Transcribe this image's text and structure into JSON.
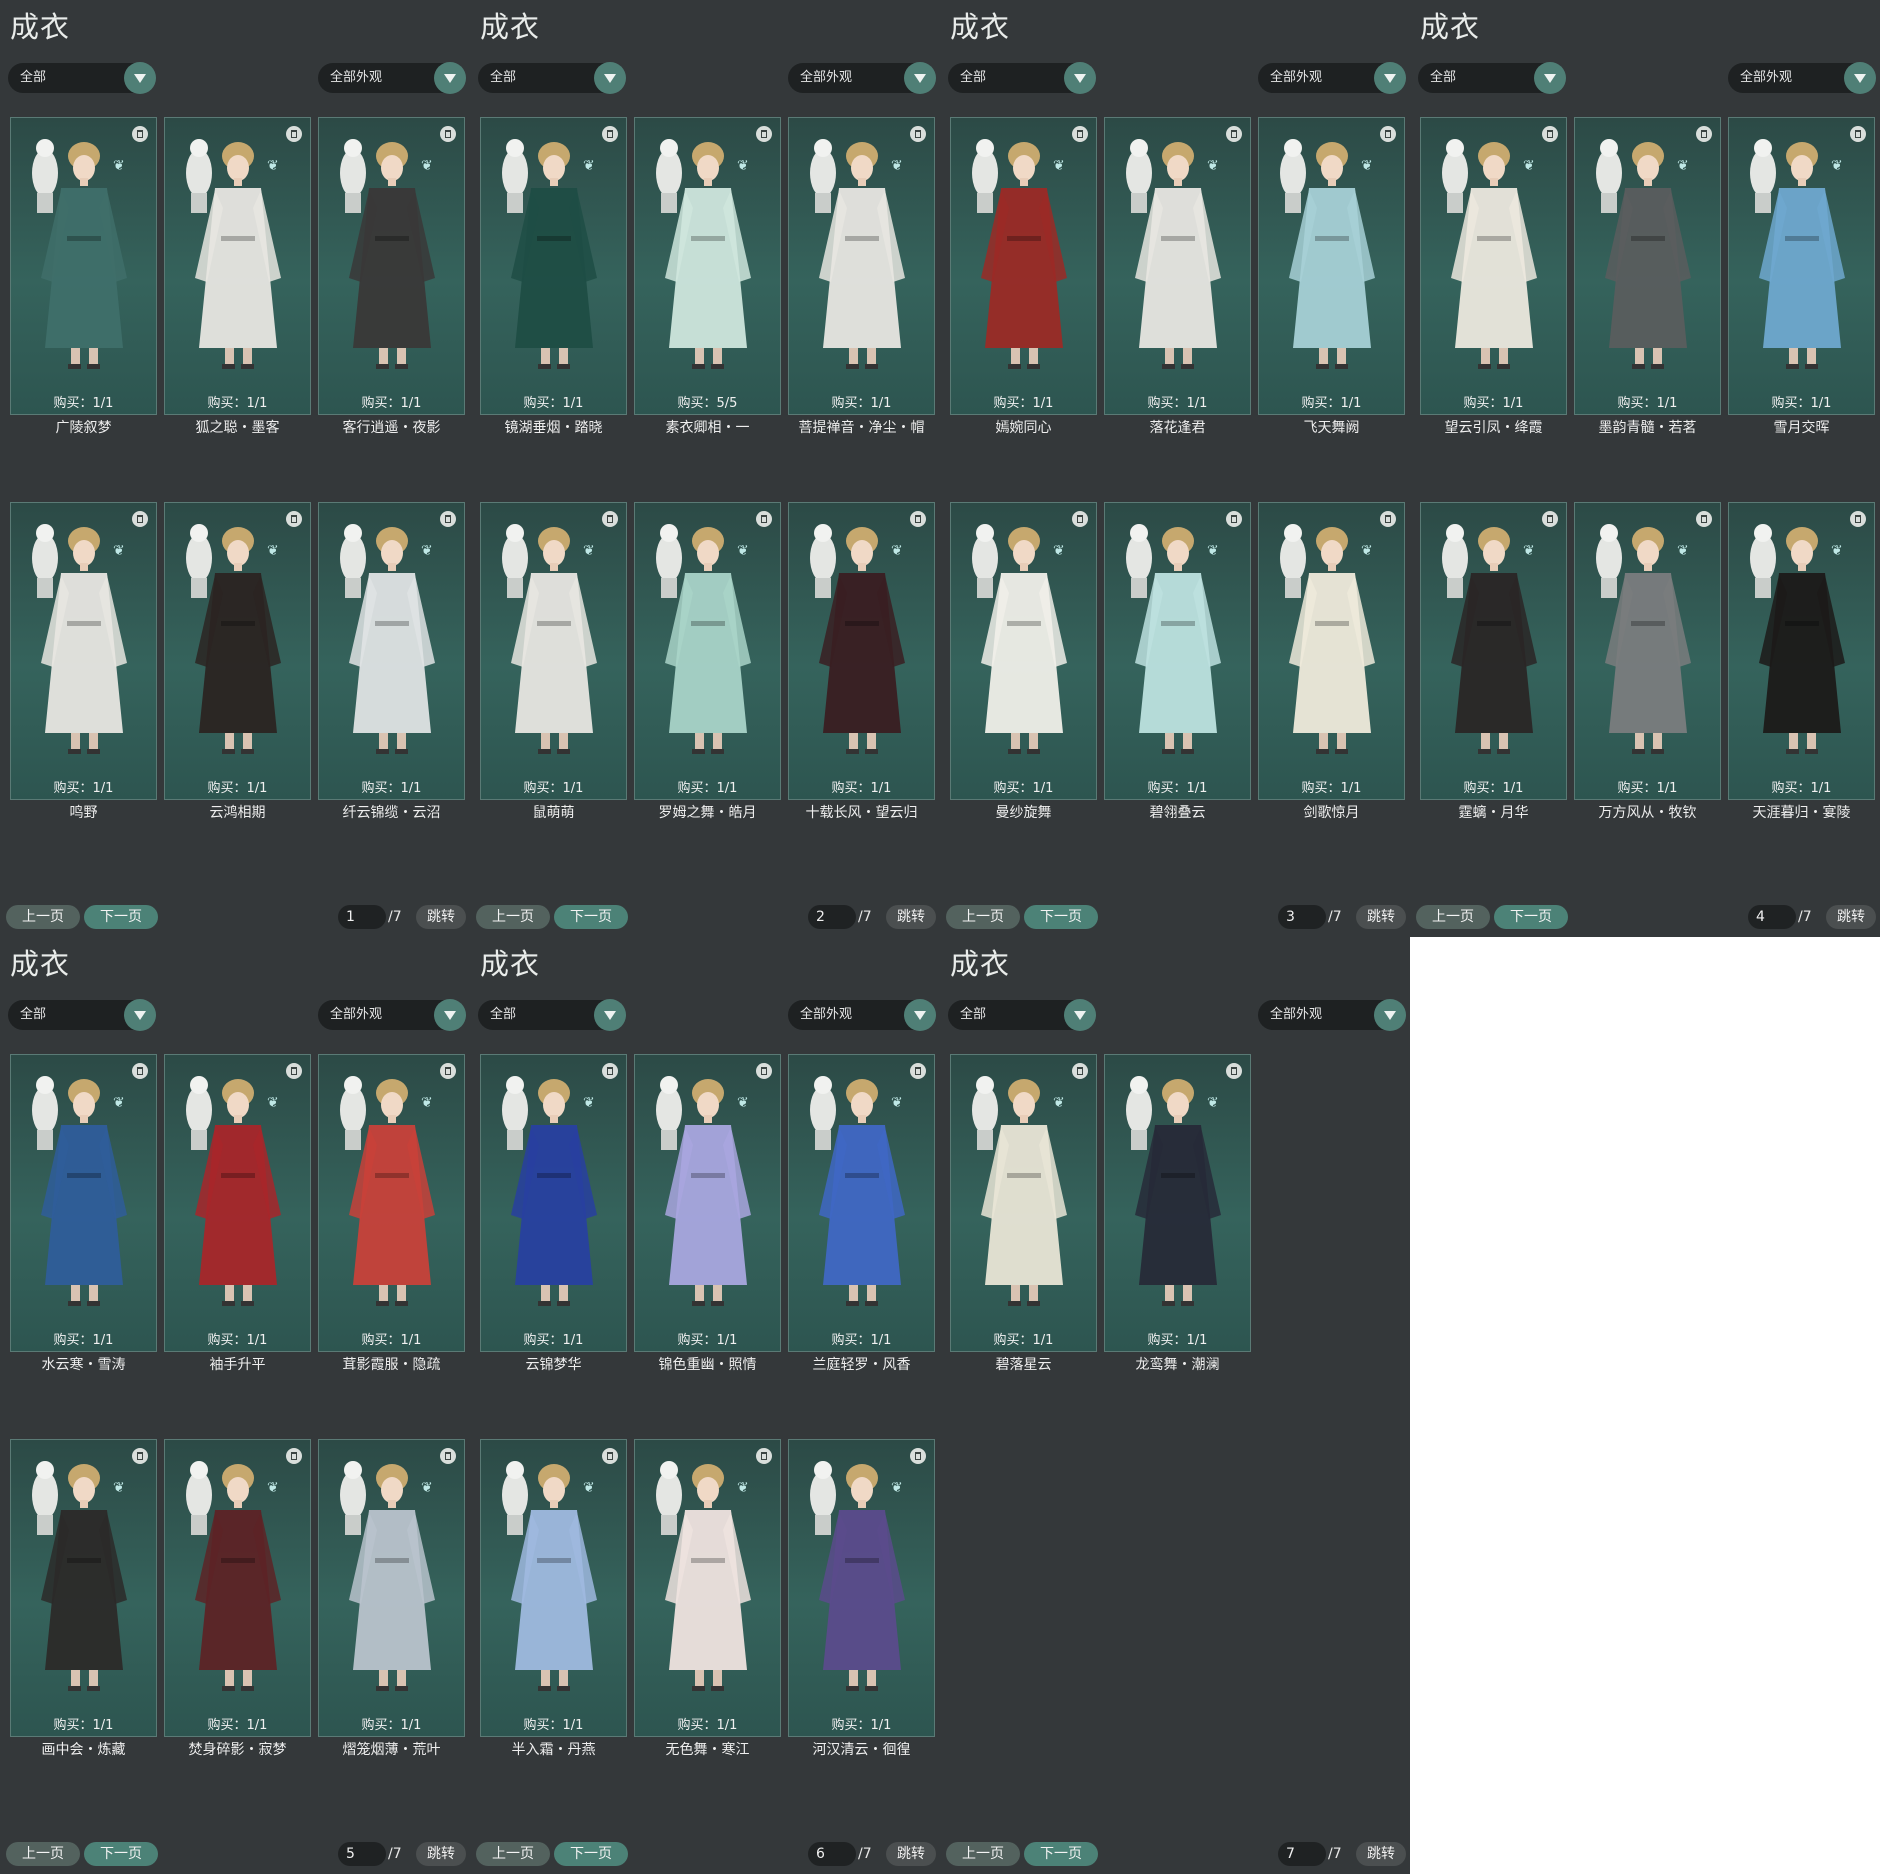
{
  "panel_title": "成衣",
  "filter_all": "全部",
  "filter_appearance": "全部外观",
  "prev_label": "上一页",
  "next_label": "下一页",
  "jump_label": "跳转",
  "total_pages": "/7",
  "pages": [
    {
      "page": "1",
      "items": [
        {
          "name": "广陵叙梦",
          "buy": "购买：1/1",
          "outfit": "#3f6f6a"
        },
        {
          "name": "狐之聪・墨客",
          "buy": "购买：1/1",
          "outfit": "#e8e6e1"
        },
        {
          "name": "客行逍遥・夜影",
          "buy": "购买：1/1",
          "outfit": "#3a3838"
        },
        {
          "name": "鸣野",
          "buy": "购买：1/1",
          "outfit": "#e8e6e1"
        },
        {
          "name": "云鸿相期",
          "buy": "购买：1/1",
          "outfit": "#2b2422"
        },
        {
          "name": "纤云锦缆・云沼",
          "buy": "购买：1/1",
          "outfit": "#dfe3e4"
        }
      ]
    },
    {
      "page": "2",
      "items": [
        {
          "name": "镜湖垂烟・踏晓",
          "buy": "购买：1/1",
          "outfit": "#1f4d45"
        },
        {
          "name": "素衣卿相・一",
          "buy": "购买：5/5",
          "outfit": "#cfe6dd"
        },
        {
          "name": "菩提禅音・净尘・帽",
          "buy": "购买：1/1",
          "outfit": "#e8e6e1"
        },
        {
          "name": "鼠萌萌",
          "buy": "购买：1/1",
          "outfit": "#e8e6e1"
        },
        {
          "name": "罗姆之舞・皓月",
          "buy": "购买：1/1",
          "outfit": "#a9d3c8"
        },
        {
          "name": "十载长风・望云归",
          "buy": "购买：1/1",
          "outfit": "#3a1e22"
        }
      ]
    },
    {
      "page": "3",
      "items": [
        {
          "name": "嫣婉同心",
          "buy": "购买：1/1",
          "outfit": "#9b2a26"
        },
        {
          "name": "落花逢君",
          "buy": "购买：1/1",
          "outfit": "#e8e6e1"
        },
        {
          "name": "飞天舞阙",
          "buy": "购买：1/1",
          "outfit": "#a7d0d6"
        },
        {
          "name": "曼纱旋舞",
          "buy": "购买：1/1",
          "outfit": "#f0efe9"
        },
        {
          "name": "碧翎叠云",
          "buy": "购买：1/1",
          "outfit": "#bde1df"
        },
        {
          "name": "剑歌惊月",
          "buy": "购买：1/1",
          "outfit": "#efeadb"
        }
      ]
    },
    {
      "page": "4",
      "items": [
        {
          "name": "望云引凤・绛霞",
          "buy": "购买：1/1",
          "outfit": "#ece8de"
        },
        {
          "name": "墨韵青髓・若茗",
          "buy": "购买：1/1",
          "outfit": "#5a5d5e"
        },
        {
          "name": "雪月交晖",
          "buy": "购买：1/1",
          "outfit": "#6fa8cf"
        },
        {
          "name": "霆螭・月华",
          "buy": "购买：1/1",
          "outfit": "#2a2626"
        },
        {
          "name": "万方风从・牧钦",
          "buy": "购买：1/1",
          "outfit": "#7a7c7e"
        },
        {
          "name": "天涯暮归・宴陵",
          "buy": "购买：1/1",
          "outfit": "#1c1a19"
        }
      ]
    },
    {
      "page": "5",
      "items": [
        {
          "name": "水云寒・雪涛",
          "buy": "购买：1/1",
          "outfit": "#2f5d9a"
        },
        {
          "name": "袖手升平",
          "buy": "购买：1/1",
          "outfit": "#a8262a"
        },
        {
          "name": "茸影霞服・隐疏",
          "buy": "购买：1/1",
          "outfit": "#c8413a"
        },
        {
          "name": "画中会・炼藏",
          "buy": "购买：1/1",
          "outfit": "#2c2a29"
        },
        {
          "name": "焚身碎影・寂梦",
          "buy": "购买：1/1",
          "outfit": "#5d2326"
        },
        {
          "name": "熠笼烟薄・荒叶",
          "buy": "购买：1/1",
          "outfit": "#b9c3cc"
        }
      ]
    },
    {
      "page": "6",
      "items": [
        {
          "name": "云锦梦华",
          "buy": "购买：1/1",
          "outfit": "#2840a0"
        },
        {
          "name": "锦色重幽・照情",
          "buy": "购买：1/1",
          "outfit": "#a9a6df"
        },
        {
          "name": "兰庭轻罗・风香",
          "buy": "购买：1/1",
          "outfit": "#4067c4"
        },
        {
          "name": "半入霜・丹燕",
          "buy": "购买：1/1",
          "outfit": "#9fb9df"
        },
        {
          "name": "无色舞・寒江",
          "buy": "购买：1/1",
          "outfit": "#efe3df"
        },
        {
          "name": "河汉清云・徊徨",
          "buy": "购买：1/1",
          "outfit": "#5b4b8c"
        }
      ]
    },
    {
      "page": "7",
      "items": [
        {
          "name": "碧落星云",
          "buy": "购买：1/1",
          "outfit": "#e9e5d6"
        },
        {
          "name": "龙鸾舞・潮澜",
          "buy": "购买：1/1",
          "outfit": "#272a38"
        }
      ]
    }
  ]
}
